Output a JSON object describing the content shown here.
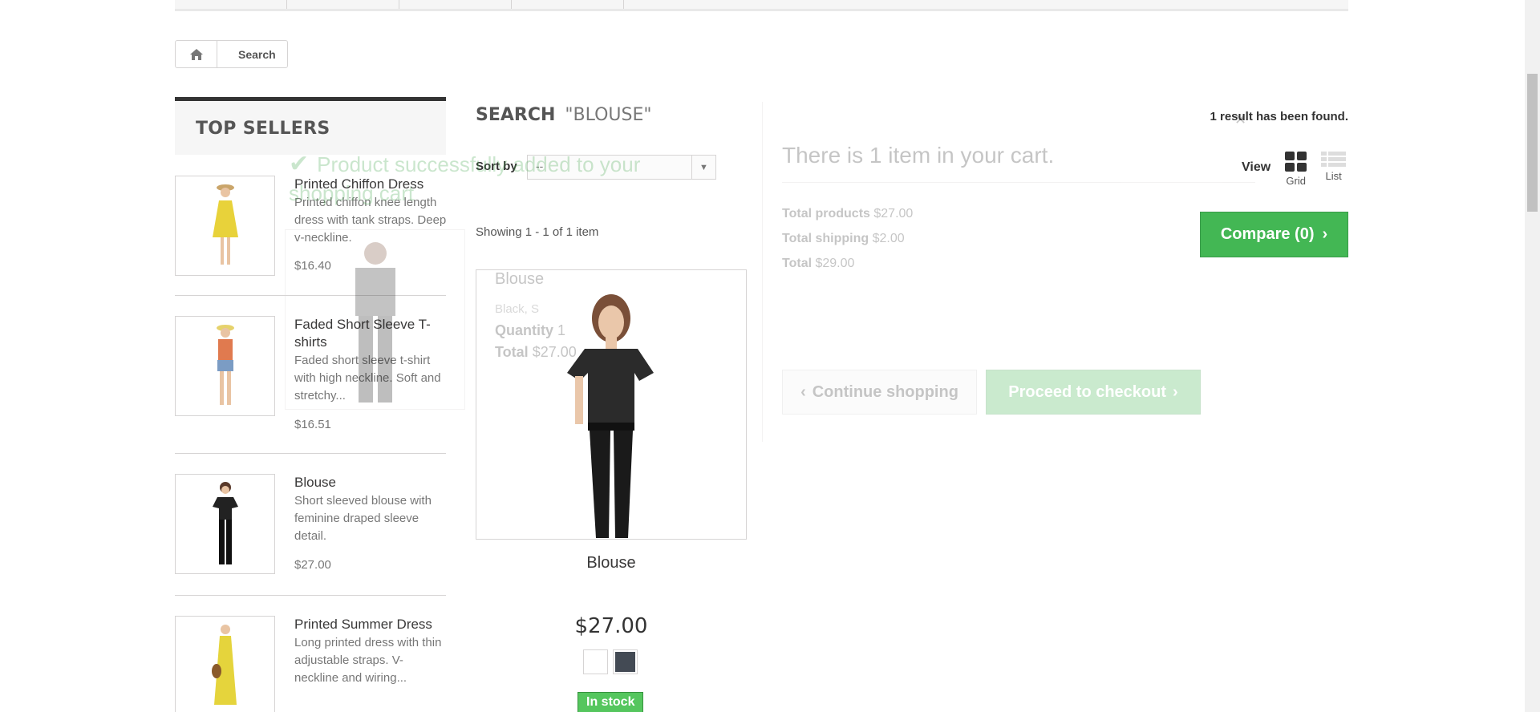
{
  "breadcrumb": {
    "home_icon": "home-icon",
    "current": "Search"
  },
  "top_sellers": {
    "title": "TOP SELLERS",
    "items": [
      {
        "name": "Printed Chiffon Dress",
        "description": "Printed chiffon knee length dress with tank straps. Deep v-neckline.",
        "price": "$16.40",
        "dress_color": "#e8d23a"
      },
      {
        "name": "Faded Short Sleeve T-shirts",
        "description": "Faded short sleeve t-shirt with high neckline. Soft and stretchy...",
        "price": "$16.51",
        "dress_color": "#e07a4f"
      },
      {
        "name": "Blouse",
        "description": "Short sleeved blouse with feminine draped sleeve detail.",
        "price": "$27.00",
        "dress_color": "#222222"
      },
      {
        "name": "Printed Summer Dress",
        "description": "Long printed dress with thin adjustable straps. V-neckline and wiring...",
        "price": "",
        "dress_color": "#e5d43c"
      }
    ]
  },
  "search": {
    "heading": "SEARCH",
    "query": "\"BLOUSE\"",
    "result_count": "1 result has been found.",
    "sort_label": "Sort by",
    "sort_value": "--",
    "showing": "Showing 1 - 1 of 1 item",
    "view_label": "View",
    "view_grid": "Grid",
    "view_list": "List",
    "compare_label": "Compare (0)"
  },
  "product": {
    "name": "Blouse",
    "price": "$27.00",
    "swatches": [
      "#ffffff",
      "#434a54"
    ],
    "availability": "In stock"
  },
  "cart_layer": {
    "added_message": "Product successfully added to your shopping cart",
    "product_title": "Blouse",
    "product_attributes": "Black, S",
    "quantity_label": "Quantity",
    "quantity_value": "1",
    "total_label": "Total",
    "total_value": "$27.00",
    "cart_count": "There is 1 item in your cart.",
    "total_products_label": "Total products",
    "total_products_value": "$27.00",
    "total_shipping_label": "Total shipping",
    "total_shipping_value": "$2.00",
    "grand_total_label": "Total",
    "grand_total_value": "$29.00",
    "continue_label": "Continue shopping",
    "checkout_label": "Proceed to checkout"
  },
  "colors": {
    "accent_green": "#43b754",
    "dark": "#333333",
    "muted": "#777777",
    "border": "#d6d4d4"
  }
}
